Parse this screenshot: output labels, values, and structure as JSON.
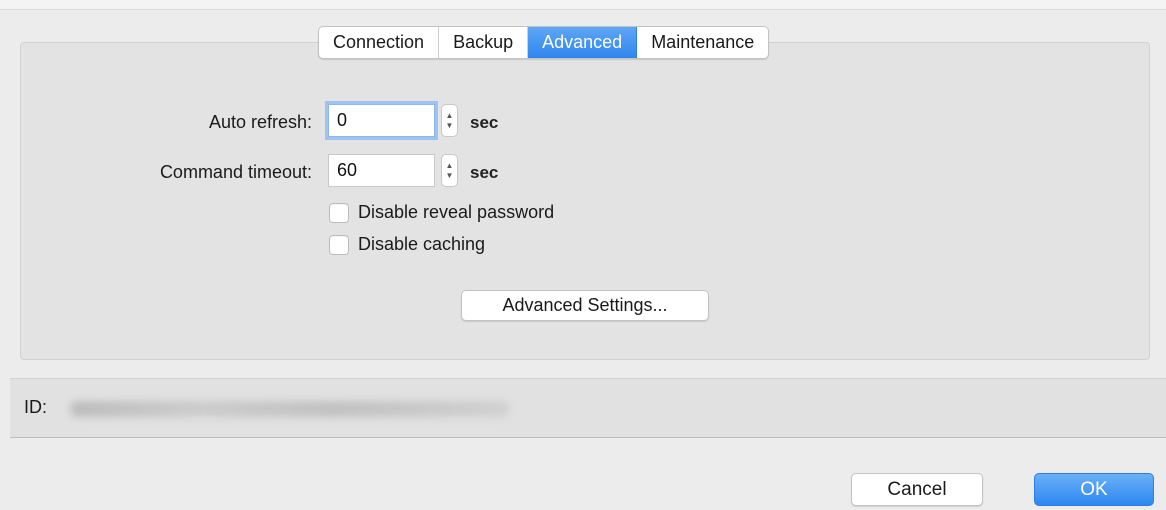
{
  "tabs": [
    {
      "label": "Connection",
      "active": false
    },
    {
      "label": "Backup",
      "active": false
    },
    {
      "label": "Advanced",
      "active": true
    },
    {
      "label": "Maintenance",
      "active": false
    }
  ],
  "form": {
    "auto_refresh": {
      "label": "Auto refresh:",
      "value": "0",
      "unit": "sec"
    },
    "command_timeout": {
      "label": "Command timeout:",
      "value": "60",
      "unit": "sec"
    },
    "checkboxes": [
      {
        "label": "Disable reveal password",
        "checked": false
      },
      {
        "label": "Disable caching",
        "checked": false
      }
    ],
    "advanced_settings_label": "Advanced Settings..."
  },
  "id_bar": {
    "label": "ID:"
  },
  "footer": {
    "cancel_label": "Cancel",
    "ok_label": "OK"
  },
  "colors": {
    "accent": "#2f86ef",
    "panel": "#e3e3e3",
    "window": "#ececec"
  },
  "icons": {
    "stepper": "stepper-arrows-icon"
  }
}
